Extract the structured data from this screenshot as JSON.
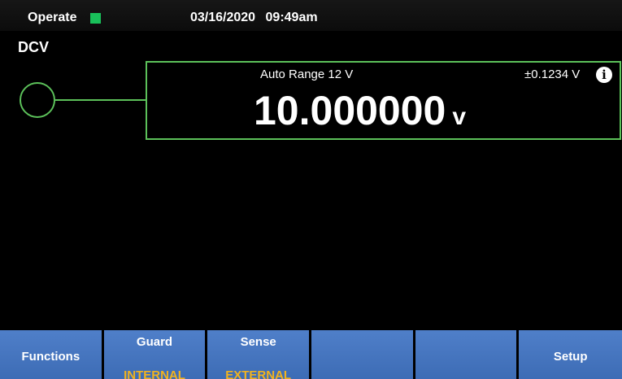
{
  "status_bar": {
    "mode": "Operate",
    "indicator_color": "#19c05a",
    "date": "03/16/2020",
    "time": "09:49am"
  },
  "function": "DCV",
  "measurement": {
    "range": "Auto Range 12 V",
    "uncertainty": "±0.1234 V",
    "info_icon": "info-icon",
    "value": "10.000000",
    "unit": "v",
    "connection_color": "#5cc15a"
  },
  "softkeys": [
    {
      "label": "Functions",
      "value": ""
    },
    {
      "label": "Guard",
      "value": "INTERNAL"
    },
    {
      "label": "Sense",
      "value": "EXTERNAL"
    },
    {
      "label": "",
      "value": ""
    },
    {
      "label": "",
      "value": ""
    },
    {
      "label": "Setup",
      "value": ""
    }
  ],
  "colors": {
    "softkey": "#4a78c2",
    "softkey_value": "#f2b31e"
  }
}
